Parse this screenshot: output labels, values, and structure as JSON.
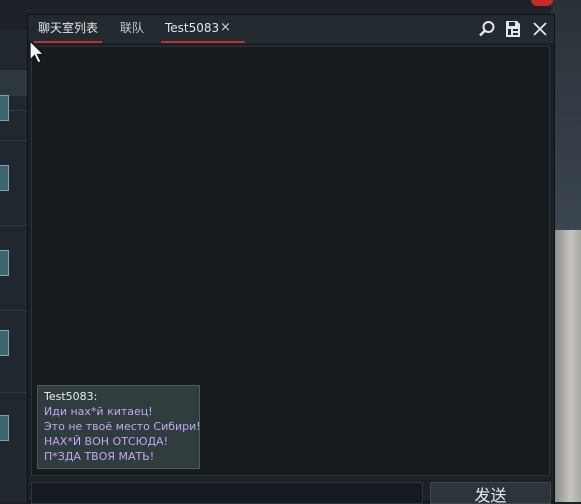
{
  "tabs": [
    {
      "label": "聊天室列表",
      "active": false
    },
    {
      "label": "联队",
      "active": false
    },
    {
      "label": "Test5083",
      "active": true,
      "closable": true
    }
  ],
  "tab_close_glyph": "×",
  "window_icons": [
    "search-icon",
    "save-icon",
    "close-icon"
  ],
  "message": {
    "sender": "Test5083:",
    "lines": [
      "Иди нах*й китаец!",
      "Это не твоё место Сибири!",
      "НАХ*Й ВОН ОТСЮДА!",
      "П*ЗДА ТВОЯ МАТЬ!"
    ]
  },
  "input": {
    "value": "",
    "placeholder": ""
  },
  "send_label": "发送",
  "colors": {
    "accent": "#c03232",
    "message_text": "#c7a6f0",
    "bubble_bg": "#2f3d3f"
  }
}
